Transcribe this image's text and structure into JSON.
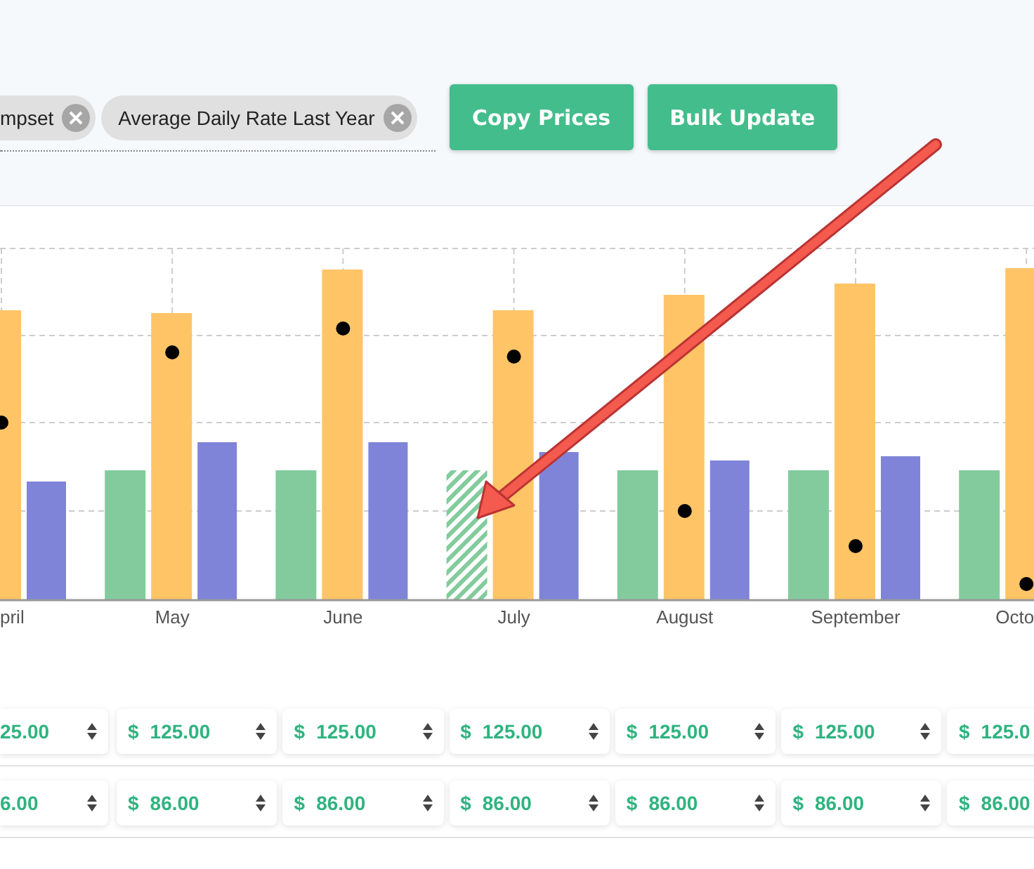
{
  "filters": {
    "chips": [
      {
        "label": "mpset"
      },
      {
        "label": "Average Daily Rate Last Year"
      }
    ]
  },
  "buttons": [
    {
      "label": "Copy Prices"
    },
    {
      "label": "Bulk Update"
    }
  ],
  "chart": {
    "months": [
      {
        "label": "pril",
        "selected": false
      },
      {
        "label": "May",
        "selected": false
      },
      {
        "label": "June",
        "selected": false
      },
      {
        "label": "July",
        "selected": true
      },
      {
        "label": "August",
        "selected": false
      },
      {
        "label": "September",
        "selected": false
      },
      {
        "label": "Octo",
        "selected": false
      }
    ]
  },
  "price_rows": [
    {
      "cells": [
        {
          "amount": "25.00"
        },
        {
          "currency": "$",
          "amount": "125.00"
        },
        {
          "currency": "$",
          "amount": "125.00"
        },
        {
          "currency": "$",
          "amount": "125.00"
        },
        {
          "currency": "$",
          "amount": "125.00"
        },
        {
          "currency": "$",
          "amount": "125.00"
        },
        {
          "currency": "$",
          "amount": "125.0"
        }
      ]
    },
    {
      "cells": [
        {
          "amount": "6.00"
        },
        {
          "currency": "$",
          "amount": "86.00"
        },
        {
          "currency": "$",
          "amount": "86.00"
        },
        {
          "currency": "$",
          "amount": "86.00"
        },
        {
          "currency": "$",
          "amount": "86.00"
        },
        {
          "currency": "$",
          "amount": "86.00"
        },
        {
          "currency": "$",
          "amount": "86.00"
        }
      ]
    }
  ]
}
